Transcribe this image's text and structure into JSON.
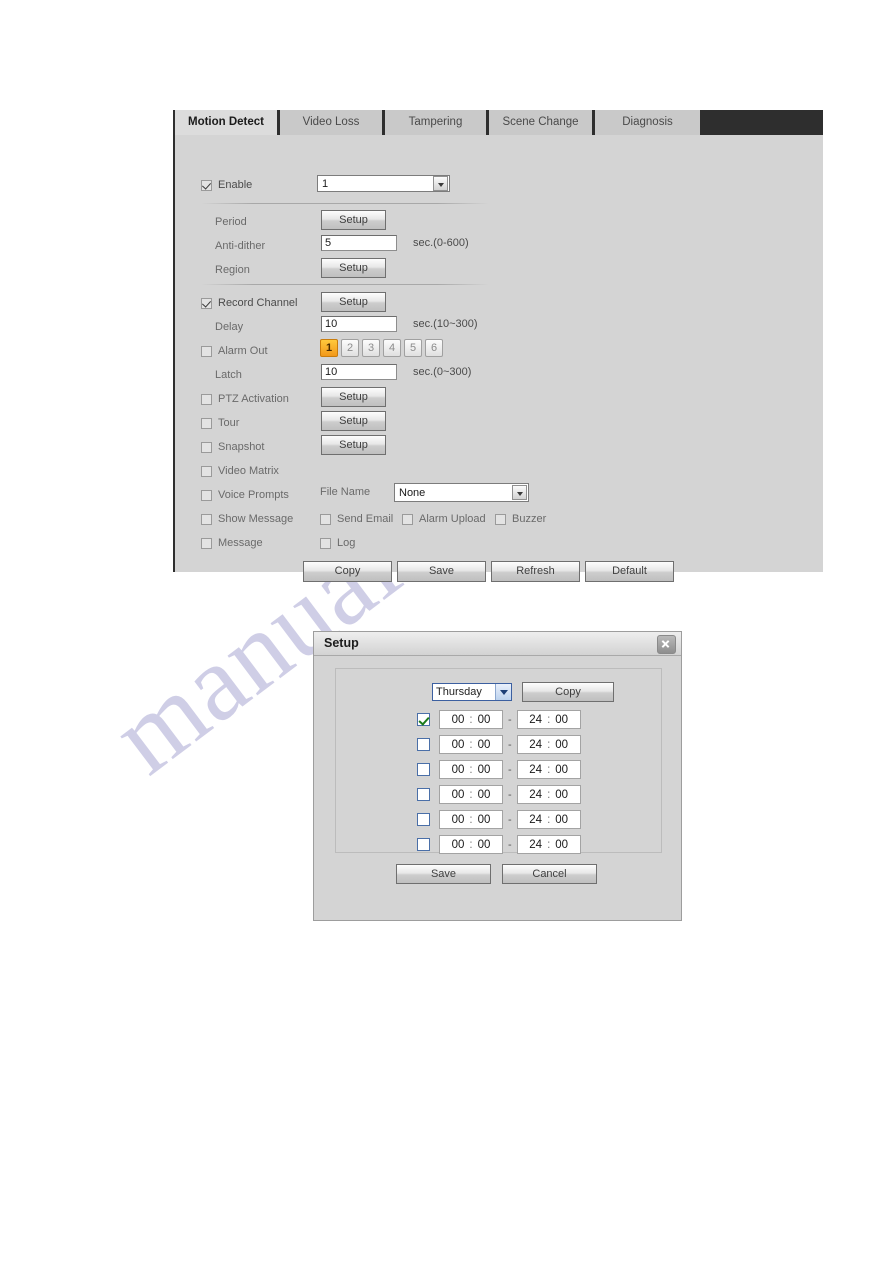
{
  "watermark": {
    "text": "manualshive.com"
  },
  "tabs": [
    {
      "label": "Motion Detect",
      "selected": true
    },
    {
      "label": "Video Loss",
      "selected": false
    },
    {
      "label": "Tampering",
      "selected": false
    },
    {
      "label": "Scene Change",
      "selected": false
    },
    {
      "label": "Diagnosis",
      "selected": false
    }
  ],
  "form": {
    "enable": {
      "label": "Enable",
      "checked": true,
      "channel_value": "1"
    },
    "period": {
      "label": "Period",
      "button": "Setup"
    },
    "anti_dither": {
      "label": "Anti-dither",
      "value": "5",
      "unit": "sec.(0-600)"
    },
    "region": {
      "label": "Region",
      "button": "Setup"
    },
    "record_channel": {
      "label": "Record Channel",
      "checked": true,
      "button": "Setup"
    },
    "delay": {
      "label": "Delay",
      "value": "10",
      "unit": "sec.(10~300)"
    },
    "alarm_out": {
      "label": "Alarm Out",
      "checked": false,
      "outputs": [
        "1",
        "2",
        "3",
        "4",
        "5",
        "6"
      ],
      "active_output": "1",
      "active_color": "#f2981a"
    },
    "latch": {
      "label": "Latch",
      "value": "10",
      "unit": "sec.(0~300)"
    },
    "ptz_activation": {
      "label": "PTZ Activation",
      "checked": false,
      "button": "Setup"
    },
    "tour": {
      "label": "Tour",
      "checked": false,
      "button": "Setup"
    },
    "snapshot": {
      "label": "Snapshot",
      "checked": false,
      "button": "Setup"
    },
    "video_matrix": {
      "label": "Video Matrix",
      "checked": false
    },
    "voice_prompts": {
      "label": "Voice Prompts",
      "checked": false
    },
    "file_name": {
      "label": "File Name",
      "value": "None"
    },
    "show_message": {
      "label": "Show Message",
      "checked": false
    },
    "send_email": {
      "label": "Send Email",
      "checked": false
    },
    "alarm_upload": {
      "label": "Alarm Upload",
      "checked": false
    },
    "buzzer": {
      "label": "Buzzer",
      "checked": false
    },
    "message": {
      "label": "Message",
      "checked": false
    },
    "log": {
      "label": "Log",
      "checked": false
    },
    "actions": {
      "copy": "Copy",
      "save": "Save",
      "refresh": "Refresh",
      "default": "Default"
    }
  },
  "dialog": {
    "title": "Setup",
    "close_icon": "close-icon",
    "day": "Thursday",
    "copy_button": "Copy",
    "separator": ":",
    "dash": "-",
    "periods": [
      {
        "enabled": true,
        "start_h": "00",
        "start_m": "00",
        "end_h": "24",
        "end_m": "00"
      },
      {
        "enabled": false,
        "start_h": "00",
        "start_m": "00",
        "end_h": "24",
        "end_m": "00"
      },
      {
        "enabled": false,
        "start_h": "00",
        "start_m": "00",
        "end_h": "24",
        "end_m": "00"
      },
      {
        "enabled": false,
        "start_h": "00",
        "start_m": "00",
        "end_h": "24",
        "end_m": "00"
      },
      {
        "enabled": false,
        "start_h": "00",
        "start_m": "00",
        "end_h": "24",
        "end_m": "00"
      },
      {
        "enabled": false,
        "start_h": "00",
        "start_m": "00",
        "end_h": "24",
        "end_m": "00"
      }
    ],
    "save_button": "Save",
    "cancel_button": "Cancel"
  }
}
